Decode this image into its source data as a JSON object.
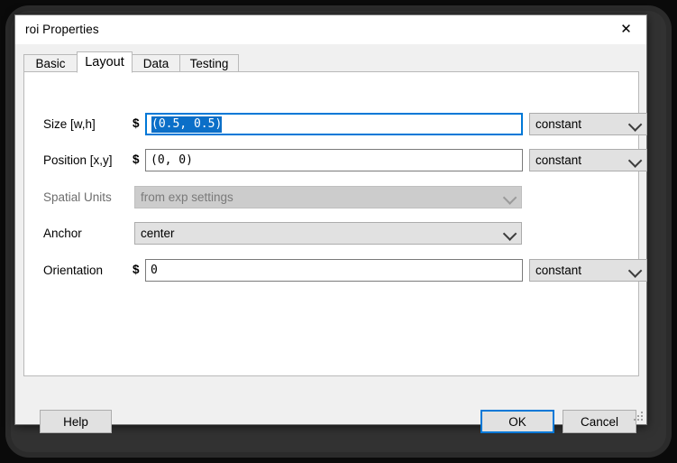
{
  "window": {
    "title": "roi Properties",
    "close_icon": "close-icon"
  },
  "tabs": [
    {
      "label": "Basic",
      "active": false
    },
    {
      "label": "Layout",
      "active": true
    },
    {
      "label": "Data",
      "active": false
    },
    {
      "label": "Testing",
      "active": false
    }
  ],
  "form": {
    "rows": [
      {
        "label": "Size [w,h]",
        "prefix": "$",
        "kind": "textbox",
        "value": "(0.5, 0.5)",
        "selected": true,
        "focused": true,
        "disabled": false,
        "mode": "constant"
      },
      {
        "label": "Position [x,y]",
        "prefix": "$",
        "kind": "textbox",
        "value": "(0, 0)",
        "selected": false,
        "focused": false,
        "disabled": false,
        "mode": "constant"
      },
      {
        "label": "Spatial Units",
        "prefix": "",
        "kind": "combobox",
        "value": "from exp settings",
        "disabled": true,
        "mode": ""
      },
      {
        "label": "Anchor",
        "prefix": "",
        "kind": "combobox",
        "value": "center",
        "disabled": false,
        "mode": ""
      },
      {
        "label": "Orientation",
        "prefix": "$",
        "kind": "textbox",
        "value": "0",
        "selected": false,
        "focused": false,
        "disabled": false,
        "mode": "constant"
      }
    ]
  },
  "footer": {
    "help_label": "Help",
    "ok_label": "OK",
    "cancel_label": "Cancel"
  },
  "colors": {
    "accent": "#0078d7",
    "selection": "#0b6fc8",
    "window_bg": "#f0f0f0",
    "panel_bg": "#ffffff",
    "control_bg": "#e1e1e1",
    "disabled_bg": "#cccccc",
    "disabled_text": "#7a7a7a"
  }
}
